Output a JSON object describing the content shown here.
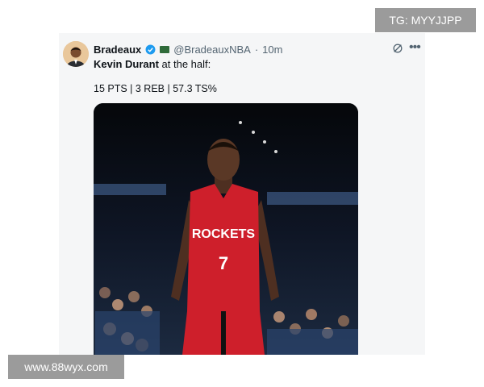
{
  "tweet": {
    "author_name": "Bradeaux",
    "handle": "@BradeauxNBA",
    "separator": "·",
    "time": "10m",
    "player_name": "Kevin Durant",
    "text_suffix": " at the half:",
    "stats": "15 PTS | 3 REB | 57.3 TS%",
    "icons": [
      "verified-badge-icon",
      "flag-icon",
      "grok-icon",
      "more-icon"
    ]
  },
  "photo": {
    "jersey_team": "ROCKETS",
    "jersey_number": "7"
  },
  "watermarks": {
    "tg": "TG: MYYJJPP",
    "www": "www.88wyx.com"
  },
  "colors": {
    "verified": "#1d9bf0",
    "jersey": "#ce1f2b",
    "watermark_bg": "#9b9b9b"
  }
}
